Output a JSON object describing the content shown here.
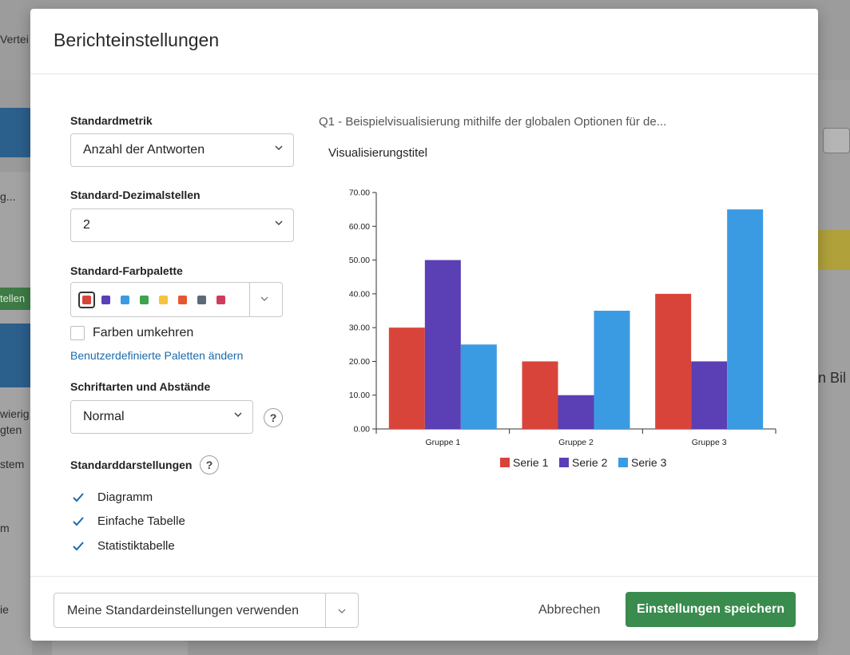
{
  "background": {
    "top_left_text": "Vertei",
    "left_texts": [
      "g...",
      "tellen",
      "wierig",
      "gten",
      "stem",
      "m",
      "ie"
    ],
    "right_text": "n Bil"
  },
  "modal": {
    "title": "Berichteinstellungen",
    "metric": {
      "label": "Standardmetrik",
      "value": "Anzahl der Antworten"
    },
    "decimals": {
      "label": "Standard-Dezimalstellen",
      "value": "2"
    },
    "palette": {
      "label": "Standard-Farbpalette",
      "colors": [
        "#d9443a",
        "#5a3fb5",
        "#3b9be2",
        "#3fa34d",
        "#f2c53d",
        "#e5572e",
        "#5b6a78",
        "#d13b5b"
      ],
      "invert_label": "Farben umkehren",
      "invert_checked": false,
      "custom_link": "Benutzerdefinierte Paletten ändern"
    },
    "fonts": {
      "label": "Schriftarten und Abstände",
      "value": "Normal"
    },
    "default_views": {
      "label": "Standarddarstellungen",
      "items": [
        {
          "label": "Diagramm",
          "checked": true
        },
        {
          "label": "Einfache Tabelle",
          "checked": true
        },
        {
          "label": "Statistiktabelle",
          "checked": true
        }
      ]
    },
    "preview": {
      "question_title": "Q1 - Beispielvisualisierung mithilfe der globalen Optionen für de...",
      "viz_title": "Visualisierungstitel"
    },
    "footer": {
      "defaults_button": "Meine Standardeinstellungen verwenden",
      "cancel_button": "Abbrechen",
      "save_button": "Einstellungen speichern"
    }
  },
  "chart_data": {
    "type": "bar",
    "categories": [
      "Gruppe 1",
      "Gruppe 2",
      "Gruppe 3"
    ],
    "series": [
      {
        "name": "Serie 1",
        "color": "#d9443a",
        "values": [
          30,
          20,
          40
        ]
      },
      {
        "name": "Serie 2",
        "color": "#5a3fb5",
        "values": [
          50,
          10,
          20
        ]
      },
      {
        "name": "Serie 3",
        "color": "#3b9be2",
        "values": [
          25,
          35,
          65
        ]
      }
    ],
    "yticks": [
      "0.00",
      "10.00",
      "20.00",
      "30.00",
      "40.00",
      "50.00",
      "60.00",
      "70.00"
    ],
    "ylim": [
      0,
      70
    ],
    "legend": "bottom"
  }
}
